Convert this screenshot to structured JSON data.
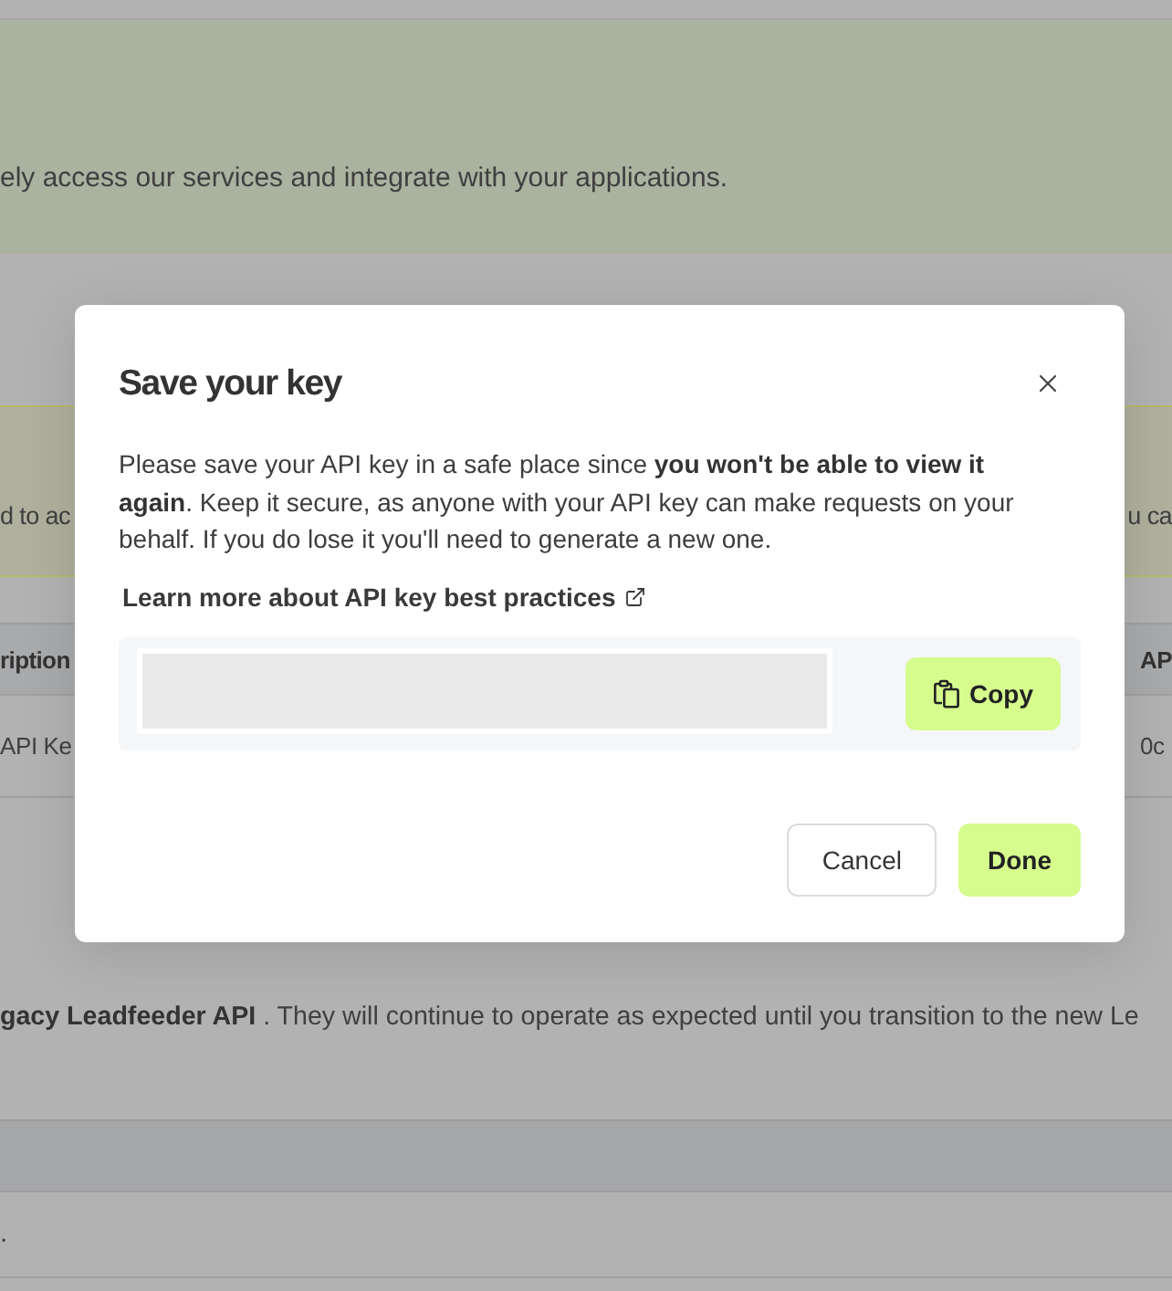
{
  "background": {
    "banner": {
      "text": "ely access our services and integrate with your applications."
    },
    "notice": {
      "text_left": "d to ac",
      "text_right": "u ca"
    },
    "keys_table": {
      "columns": [
        "ription",
        "AP"
      ],
      "rows": [
        [
          "API Ke",
          "0c"
        ]
      ]
    },
    "legacy_note": {
      "text": "**gacy Leadfeeder API** . They will continue to operate as expected until you transition to the new Le"
    },
    "legacy_table": {
      "rows": [
        [
          "."
        ]
      ]
    }
  },
  "dialog": {
    "title": "Save your key",
    "message": "Please save your API key in a safe place since **you won't be able to view it again**. Keep it secure, as anyone with your API key can make requests on your behalf. If you do lose it you'll need to generate a new one.",
    "link": "Learn more about API key best practices",
    "copy_button": "Copy",
    "buttons": [
      {
        "label": "Cancel",
        "kind": "secondary"
      },
      {
        "label": "Done",
        "kind": "primary"
      }
    ]
  }
}
